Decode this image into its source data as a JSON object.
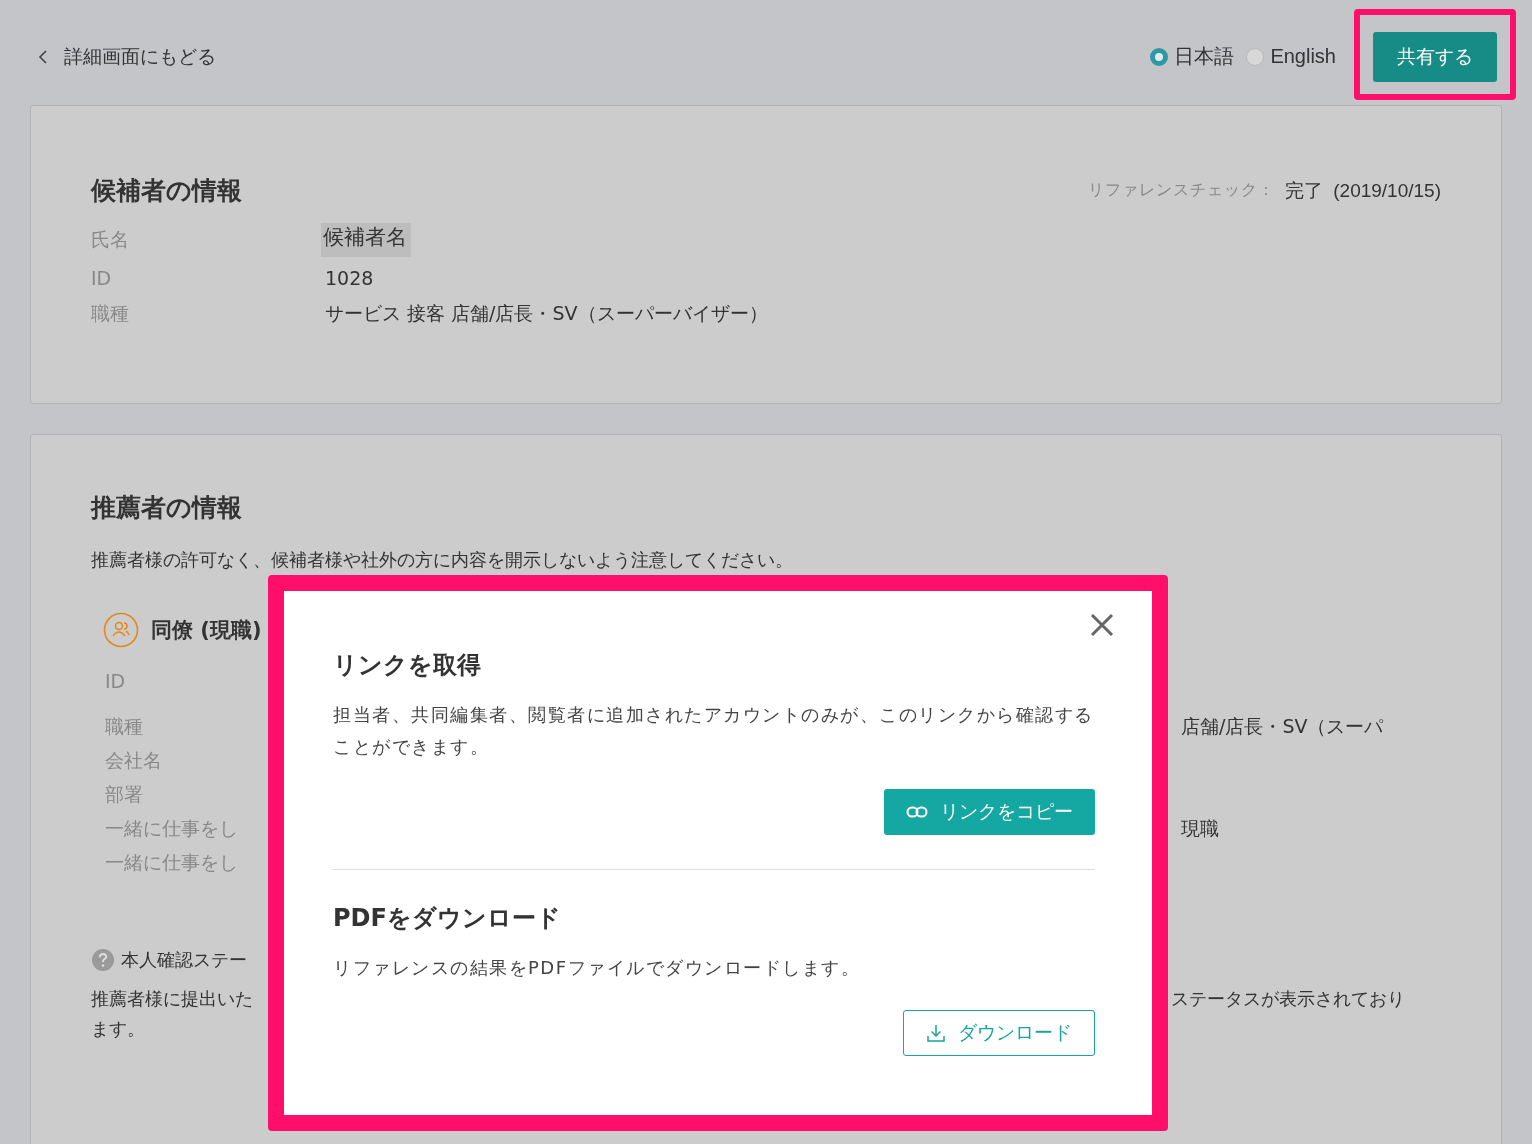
{
  "back_link": {
    "label": "詳細画面にもどる"
  },
  "language_options": [
    {
      "label": "日本語",
      "selected": true
    },
    {
      "label": "English",
      "selected": false
    }
  ],
  "share_button": {
    "label": "共有する",
    "highlighted": true
  },
  "candidate": {
    "title": "候補者の情報",
    "status_label": "リファレンスチェック：",
    "status_value": "完了",
    "status_date": "(2019/10/15)",
    "fields": [
      {
        "label": "氏名",
        "value": "候補者名",
        "highlighted": true
      },
      {
        "label": "ID",
        "value": "1028",
        "highlighted": false
      },
      {
        "label": "職種",
        "value": "サービス 接客 店舗/店長・SV（スーパーバイザー）",
        "highlighted": false
      }
    ]
  },
  "referrer": {
    "title": "推薦者の情報",
    "notice": "推薦者様の許可なく、候補者様や社外の方に内容を開示しないよう注意してください。",
    "relation": "同僚 (現職)",
    "rows": [
      {
        "label": "ID"
      },
      {
        "label": "職種",
        "value": "店舗/店長・SV（スーパ"
      },
      {
        "label": "会社名"
      },
      {
        "label": "部署"
      },
      {
        "label": "一緒に仕事をし",
        "value": "現職"
      },
      {
        "label": "一緒に仕事をし"
      }
    ],
    "status_title": "本人確認ステー",
    "status_lines": [
      "推薦者様に提出いた",
      "ます。"
    ],
    "status_right": "ステータスが表示されており"
  },
  "dialog": {
    "highlighted": true,
    "sections": [
      {
        "title": "リンクを取得",
        "text": "担当者、共同編集者、閲覧者に追加されたアカウントのみが、このリンクから確認することができます。",
        "button": {
          "label": "リンクをコピー",
          "kind": "primary"
        }
      },
      {
        "title": "PDFをダウンロード",
        "text": "リファレンスの結果をPDFファイルでダウンロードします。",
        "button": {
          "label": "ダウンロード",
          "kind": "outline"
        }
      }
    ]
  }
}
